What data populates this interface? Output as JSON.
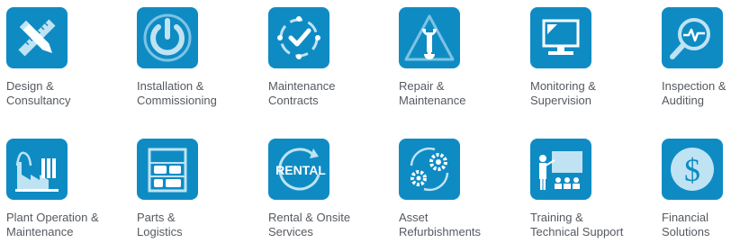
{
  "colors": {
    "tile": "#0f8bc4",
    "icon_light": "#bfe3f3",
    "label_text": "#555a60"
  },
  "services": [
    {
      "icon": "ruler-pencil-icon",
      "line1": "Design &",
      "line2": "Consultancy"
    },
    {
      "icon": "power-icon",
      "line1": "Installation &",
      "line2": "Commissioning"
    },
    {
      "icon": "check-cycle-icon",
      "line1": "Maintenance",
      "line2": "Contracts"
    },
    {
      "icon": "warning-wrench-icon",
      "line1": "Repair &",
      "line2": "Maintenance"
    },
    {
      "icon": "monitor-icon",
      "line1": "Monitoring &",
      "line2": "Supervision"
    },
    {
      "icon": "magnifier-pulse-icon",
      "line1": "Inspection &",
      "line2": "Auditing"
    },
    {
      "icon": "factory-icon",
      "line1": "Plant Operation &",
      "line2": "Maintenance"
    },
    {
      "icon": "shelves-icon",
      "line1": "Parts &",
      "line2": "Logistics"
    },
    {
      "icon": "rental-icon",
      "line1": "Rental & Onsite",
      "line2": "Services",
      "icon_text": "RENTAL"
    },
    {
      "icon": "gears-cycle-icon",
      "line1": "Asset",
      "line2": "Refurbishments"
    },
    {
      "icon": "training-board-icon",
      "line1": "Training &",
      "line2": "Technical Support"
    },
    {
      "icon": "dollar-icon",
      "line1": "Financial",
      "line2": "Solutions",
      "icon_text": "$"
    }
  ]
}
